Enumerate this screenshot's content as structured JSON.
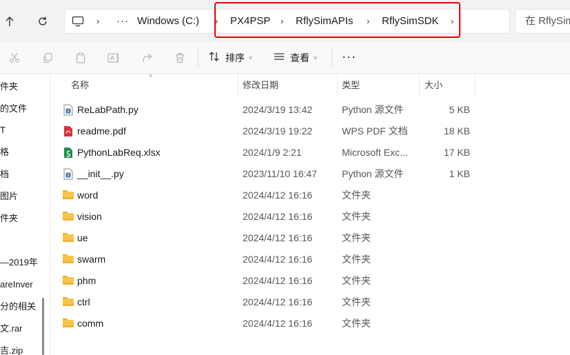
{
  "address_bar": {
    "crumbs": [
      "Windows (C:)",
      "PX4PSP",
      "RflySimAPIs",
      "RflySimSDK"
    ],
    "search_placeholder": "在 RflySim"
  },
  "toolbar": {
    "sort_label": "排序",
    "view_label": "查看",
    "more_label": "···"
  },
  "nav_pane": {
    "items": [
      "件夹",
      "的文件",
      "T",
      "格",
      "档",
      "图片",
      "件夹",
      "—2019年",
      "areInver",
      "分的相关",
      "文.rar",
      "吉.zip"
    ]
  },
  "columns": {
    "name": "名称",
    "date": "修改日期",
    "type": "类型",
    "size": "大小"
  },
  "files": [
    {
      "name": "ReLabPath.py",
      "date": "2024/3/19 13:42",
      "type": "Python 源文件",
      "size": "5 KB",
      "icon": "python-file-icon"
    },
    {
      "name": "readme.pdf",
      "date": "2024/3/19 19:22",
      "type": "WPS PDF 文档",
      "size": "18 KB",
      "icon": "pdf-file-icon"
    },
    {
      "name": "PythonLabReq.xlsx",
      "date": "2024/1/9 2:21",
      "type": "Microsoft Exc...",
      "size": "17 KB",
      "icon": "excel-file-icon"
    },
    {
      "name": "__init__.py",
      "date": "2023/11/10 16:47",
      "type": "Python 源文件",
      "size": "1 KB",
      "icon": "python-file-icon"
    },
    {
      "name": "word",
      "date": "2024/4/12 16:16",
      "type": "文件夹",
      "size": "",
      "icon": "folder-icon"
    },
    {
      "name": "vision",
      "date": "2024/4/12 16:16",
      "type": "文件夹",
      "size": "",
      "icon": "folder-icon"
    },
    {
      "name": "ue",
      "date": "2024/4/12 16:16",
      "type": "文件夹",
      "size": "",
      "icon": "folder-icon"
    },
    {
      "name": "swarm",
      "date": "2024/4/12 16:16",
      "type": "文件夹",
      "size": "",
      "icon": "folder-icon"
    },
    {
      "name": "phm",
      "date": "2024/4/12 16:16",
      "type": "文件夹",
      "size": "",
      "icon": "folder-icon"
    },
    {
      "name": "ctrl",
      "date": "2024/4/12 16:16",
      "type": "文件夹",
      "size": "",
      "icon": "folder-icon"
    },
    {
      "name": "comm",
      "date": "2024/4/12 16:16",
      "type": "文件夹",
      "size": "",
      "icon": "folder-icon"
    }
  ],
  "colors": {
    "highlight_border": "#e60000",
    "folder_yellow": "#f8c44a",
    "pdf_red": "#d9323a",
    "excel_green": "#1f8f4e",
    "python_blue": "#3b78c4"
  }
}
